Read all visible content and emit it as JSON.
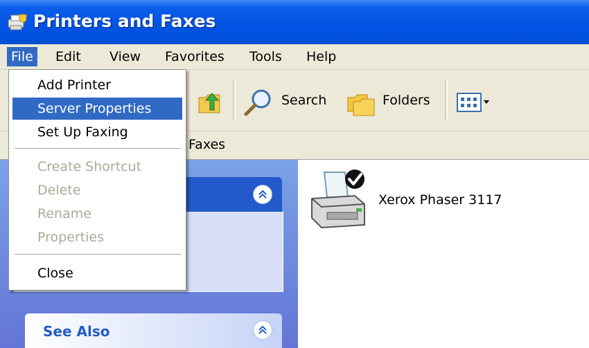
{
  "window": {
    "title": "Printers and Faxes"
  },
  "menubar": {
    "items": [
      {
        "label": "File"
      },
      {
        "label": "Edit"
      },
      {
        "label": "View"
      },
      {
        "label": "Favorites"
      },
      {
        "label": "Tools"
      },
      {
        "label": "Help"
      }
    ]
  },
  "toolbar": {
    "search_label": "Search",
    "folders_label": "Folders"
  },
  "addressbar": {
    "text": "Faxes"
  },
  "file_menu": {
    "items": [
      {
        "label": "Add Printer"
      },
      {
        "label": "Server Properties"
      },
      {
        "label": "Set Up Faxing"
      },
      {
        "label": "Create Shortcut"
      },
      {
        "label": "Delete"
      },
      {
        "label": "Rename"
      },
      {
        "label": "Properties"
      },
      {
        "label": "Close"
      }
    ]
  },
  "tasks_pane": {
    "see_also_title": "See Also"
  },
  "content": {
    "printers": [
      {
        "name": "Xerox Phaser 3117",
        "status_icon": "default-printer-check-icon"
      }
    ]
  },
  "colors": {
    "title_bar": "#0054e3",
    "menu_highlight": "#316ac5",
    "task_pane": "#6f8fde",
    "see_also_title": "#215dc6"
  }
}
